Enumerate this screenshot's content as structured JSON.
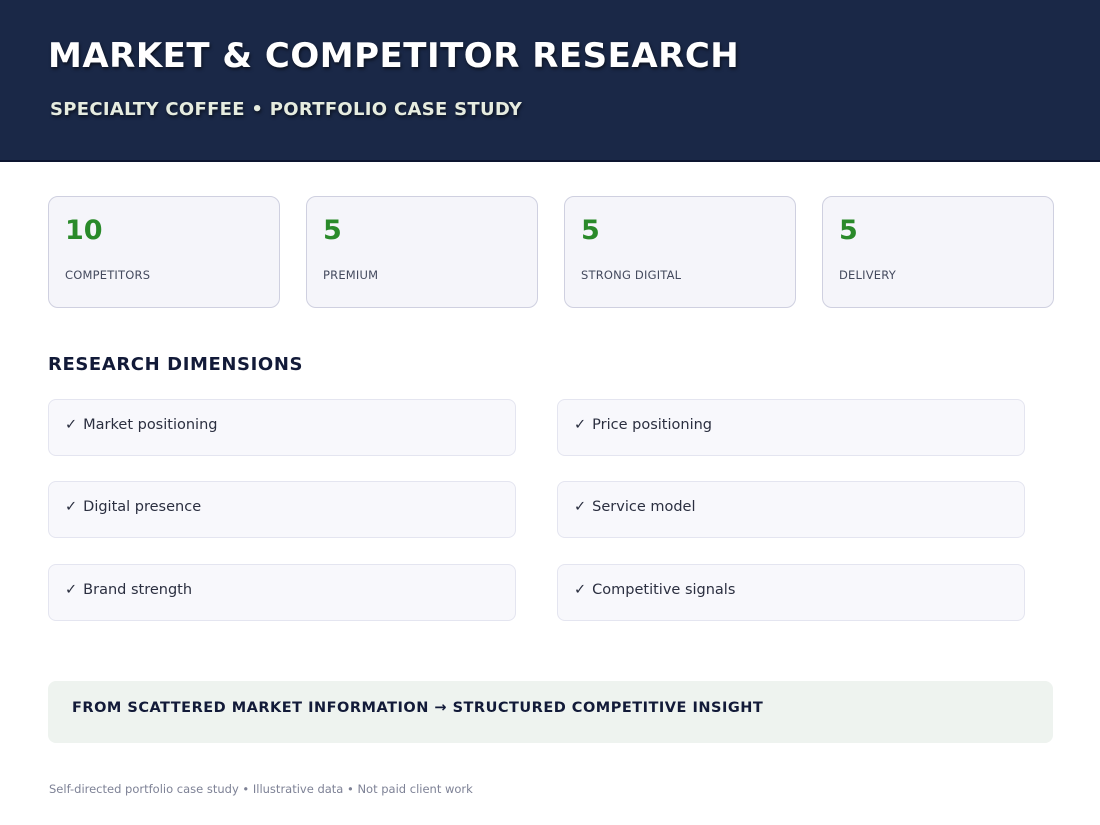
{
  "header": {
    "title": "MARKET & COMPETITOR RESEARCH",
    "subtitle": "SPECIALTY COFFEE • PORTFOLIO CASE STUDY"
  },
  "stats": [
    {
      "value": "10",
      "label": "COMPETITORS"
    },
    {
      "value": "5",
      "label": "PREMIUM"
    },
    {
      "value": "5",
      "label": "STRONG DIGITAL"
    },
    {
      "value": "5",
      "label": "DELIVERY"
    }
  ],
  "dimensions": {
    "title": "RESEARCH DIMENSIONS",
    "check_icon": "check-icon",
    "check_glyph": "✓",
    "items": [
      "Market positioning",
      "Price positioning",
      "Digital presence",
      "Service model",
      "Brand strength",
      "Competitive signals"
    ]
  },
  "insight": {
    "text": "FROM SCATTERED MARKET INFORMATION → STRUCTURED COMPETITIVE INSIGHT"
  },
  "footer": {
    "text": "Self-directed portfolio case study • Illustrative data • Not paid client work"
  },
  "colors": {
    "header_bg": "#1a2847",
    "stat_value": "#2a8a2a",
    "insight_bg": "#eef3ef"
  }
}
